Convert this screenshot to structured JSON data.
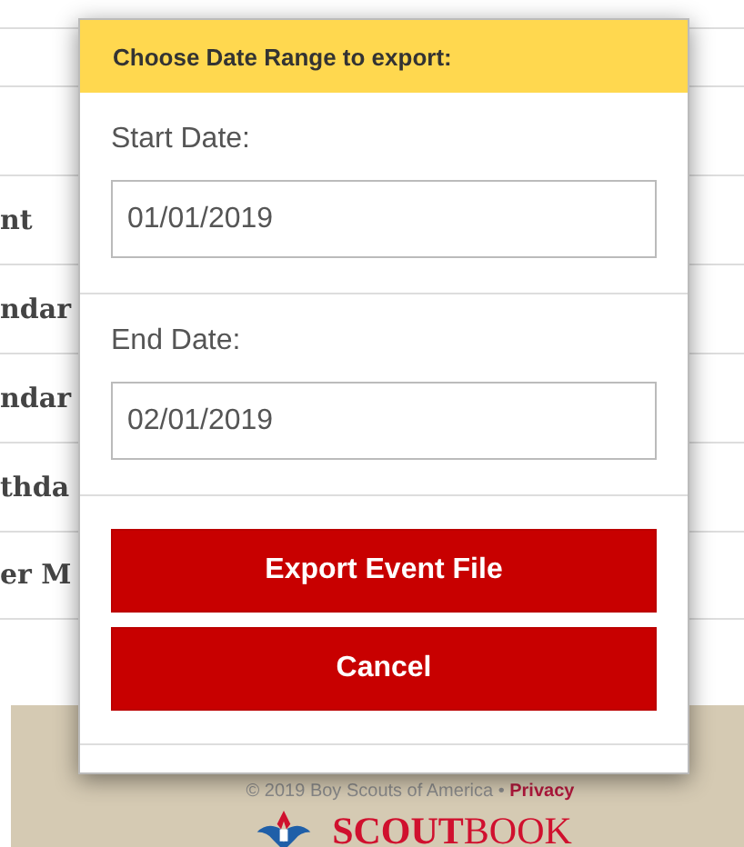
{
  "background_rows": [
    {
      "text": ""
    },
    {
      "text": ""
    },
    {
      "text": "nt"
    },
    {
      "text": "ndar"
    },
    {
      "text": "ndar"
    },
    {
      "text": "thda"
    },
    {
      "text": "er M"
    }
  ],
  "footer": {
    "copyright": "© 2019 Boy Scouts of America •",
    "privacy_link": "Privacy",
    "brand": "**SCOUT**BOOK"
  },
  "modal": {
    "title": "Choose Date Range to export:",
    "fields": [
      {
        "label": "Start Date:",
        "value": "01/01/2019"
      },
      {
        "label": "End Date:",
        "value": "02/01/2019"
      }
    ],
    "buttons": [
      "Export Event File",
      "Cancel"
    ]
  }
}
